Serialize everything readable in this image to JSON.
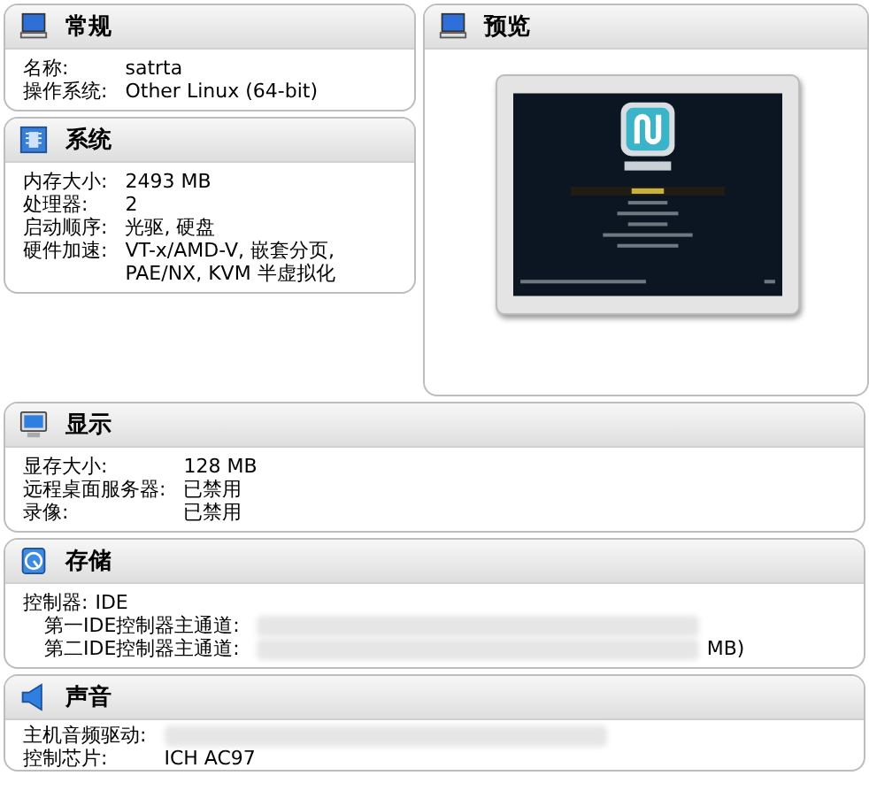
{
  "overview": [
    {
      "title": "常规",
      "rows": [
        {
          "label": "名称:",
          "value": "satrta"
        },
        {
          "label": "操作系统:",
          "value": "Other Linux (64-bit)"
        }
      ]
    },
    {
      "title": "系统",
      "rows": [
        {
          "label": "内存大小:",
          "value": "2493 MB"
        },
        {
          "label": "处理器:",
          "value": "2"
        },
        {
          "label": "启动顺序:",
          "value": "光驱, 硬盘"
        },
        {
          "label": "硬件加速:",
          "value": "VT-x/AMD-V, 嵌套分页, PAE/NX, KVM 半虚拟化"
        }
      ]
    }
  ],
  "preview": {
    "title": "预览"
  },
  "details": [
    {
      "title": "显示",
      "rows": [
        {
          "label": "显存大小:",
          "value": "128 MB"
        },
        {
          "label": "远程桌面服务器:",
          "value": "已禁用"
        },
        {
          "label": "录像:",
          "value": "已禁用"
        }
      ]
    },
    {
      "title": "存储",
      "rows": [
        {
          "kind": "inline",
          "label": "控制器:",
          "value": "IDE"
        },
        {
          "kind": "indented",
          "label": "第一IDE控制器主通道:",
          "redacted": true
        },
        {
          "kind": "indented",
          "label": "第二IDE控制器主通道:",
          "redacted": true,
          "value": "MB)"
        }
      ]
    },
    {
      "title": "声音",
      "rows": [
        {
          "label": "主机音频驱动:",
          "redacted": true
        },
        {
          "label": "控制芯片:",
          "value": "ICH AC97"
        }
      ]
    }
  ]
}
